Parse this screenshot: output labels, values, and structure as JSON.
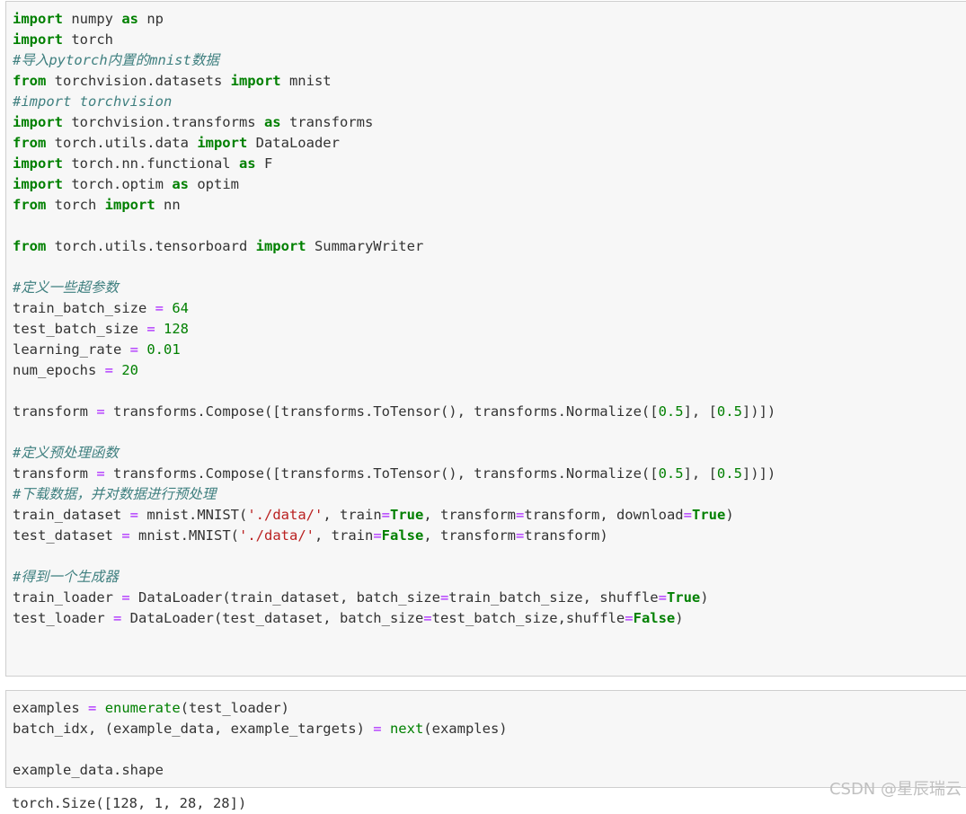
{
  "cells": [
    {
      "lines": [
        [
          [
            "kw",
            "import"
          ],
          [
            "t",
            " numpy "
          ],
          [
            "kw",
            "as"
          ],
          [
            "t",
            " np"
          ]
        ],
        [
          [
            "kw",
            "import"
          ],
          [
            "t",
            " torch"
          ]
        ],
        [
          [
            "cm",
            "#导入pytorch内置的mnist数据"
          ]
        ],
        [
          [
            "kw",
            "from"
          ],
          [
            "t",
            " torchvision.datasets "
          ],
          [
            "kw",
            "import"
          ],
          [
            "t",
            " mnist"
          ]
        ],
        [
          [
            "cm",
            "#import torchvision"
          ]
        ],
        [
          [
            "kw",
            "import"
          ],
          [
            "t",
            " torchvision.transforms "
          ],
          [
            "kw",
            "as"
          ],
          [
            "t",
            " transforms"
          ]
        ],
        [
          [
            "kw",
            "from"
          ],
          [
            "t",
            " torch.utils.data "
          ],
          [
            "kw",
            "import"
          ],
          [
            "t",
            " DataLoader"
          ]
        ],
        [
          [
            "kw",
            "import"
          ],
          [
            "t",
            " torch.nn.functional "
          ],
          [
            "kw",
            "as"
          ],
          [
            "t",
            " F"
          ]
        ],
        [
          [
            "kw",
            "import"
          ],
          [
            "t",
            " torch.optim "
          ],
          [
            "kw",
            "as"
          ],
          [
            "t",
            " optim"
          ]
        ],
        [
          [
            "kw",
            "from"
          ],
          [
            "t",
            " torch "
          ],
          [
            "kw",
            "import"
          ],
          [
            "t",
            " nn"
          ]
        ],
        [],
        [
          [
            "kw",
            "from"
          ],
          [
            "t",
            " torch.utils.tensorboard "
          ],
          [
            "kw",
            "import"
          ],
          [
            "t",
            " SummaryWriter"
          ]
        ],
        [],
        [
          [
            "cm",
            "#定义一些超参数"
          ]
        ],
        [
          [
            "t",
            "train_batch_size "
          ],
          [
            "op",
            "="
          ],
          [
            "t",
            " "
          ],
          [
            "nm",
            "64"
          ]
        ],
        [
          [
            "t",
            "test_batch_size "
          ],
          [
            "op",
            "="
          ],
          [
            "t",
            " "
          ],
          [
            "nm",
            "128"
          ]
        ],
        [
          [
            "t",
            "learning_rate "
          ],
          [
            "op",
            "="
          ],
          [
            "t",
            " "
          ],
          [
            "nm",
            "0.01"
          ]
        ],
        [
          [
            "t",
            "num_epochs "
          ],
          [
            "op",
            "="
          ],
          [
            "t",
            " "
          ],
          [
            "nm",
            "20"
          ]
        ],
        [],
        [
          [
            "t",
            "transform "
          ],
          [
            "op",
            "="
          ],
          [
            "t",
            " transforms.Compose([transforms.ToTensor(), transforms.Normalize(["
          ],
          [
            "nm",
            "0.5"
          ],
          [
            "t",
            "], ["
          ],
          [
            "nm",
            "0.5"
          ],
          [
            "t",
            "])])"
          ]
        ],
        [],
        [
          [
            "cm",
            "#定义预处理函数"
          ]
        ],
        [
          [
            "t",
            "transform "
          ],
          [
            "op",
            "="
          ],
          [
            "t",
            " transforms.Compose([transforms.ToTensor(), transforms.Normalize(["
          ],
          [
            "nm",
            "0.5"
          ],
          [
            "t",
            "], ["
          ],
          [
            "nm",
            "0.5"
          ],
          [
            "t",
            "])])"
          ]
        ],
        [
          [
            "cm",
            "#下载数据，并对数据进行预处理"
          ]
        ],
        [
          [
            "t",
            "train_dataset "
          ],
          [
            "op",
            "="
          ],
          [
            "t",
            " mnist.MNIST("
          ],
          [
            "st",
            "'./data/'"
          ],
          [
            "t",
            ", train"
          ],
          [
            "op",
            "="
          ],
          [
            "kw",
            "True"
          ],
          [
            "t",
            ", transform"
          ],
          [
            "op",
            "="
          ],
          [
            "t",
            "transform, download"
          ],
          [
            "op",
            "="
          ],
          [
            "kw",
            "True"
          ],
          [
            "t",
            ")"
          ]
        ],
        [
          [
            "t",
            "test_dataset "
          ],
          [
            "op",
            "="
          ],
          [
            "t",
            " mnist.MNIST("
          ],
          [
            "st",
            "'./data/'"
          ],
          [
            "t",
            ", train"
          ],
          [
            "op",
            "="
          ],
          [
            "kw",
            "False"
          ],
          [
            "t",
            ", transform"
          ],
          [
            "op",
            "="
          ],
          [
            "t",
            "transform)"
          ]
        ],
        [],
        [
          [
            "cm",
            "#得到一个生成器"
          ]
        ],
        [
          [
            "t",
            "train_loader "
          ],
          [
            "op",
            "="
          ],
          [
            "t",
            " DataLoader(train_dataset, batch_size"
          ],
          [
            "op",
            "="
          ],
          [
            "t",
            "train_batch_size, shuffle"
          ],
          [
            "op",
            "="
          ],
          [
            "kw",
            "True"
          ],
          [
            "t",
            ")"
          ]
        ],
        [
          [
            "t",
            "test_loader "
          ],
          [
            "op",
            "="
          ],
          [
            "t",
            " DataLoader(test_dataset, batch_size"
          ],
          [
            "op",
            "="
          ],
          [
            "t",
            "test_batch_size,shuffle"
          ],
          [
            "op",
            "="
          ],
          [
            "kw",
            "False"
          ],
          [
            "t",
            ")"
          ]
        ]
      ]
    },
    {
      "lines": [
        [
          [
            "t",
            "examples "
          ],
          [
            "op",
            "="
          ],
          [
            "t",
            " "
          ],
          [
            "bi",
            "enumerate"
          ],
          [
            "t",
            "(test_loader)"
          ]
        ],
        [
          [
            "t",
            "batch_idx, (example_data, example_targets) "
          ],
          [
            "op",
            "="
          ],
          [
            "t",
            " "
          ],
          [
            "bi",
            "next"
          ],
          [
            "t",
            "(examples)"
          ]
        ],
        [],
        [
          [
            "t",
            "example_data.shape"
          ]
        ]
      ]
    }
  ],
  "output_text": "torch.Size([128, 1, 28, 28])",
  "watermark": "CSDN @星辰瑞云"
}
